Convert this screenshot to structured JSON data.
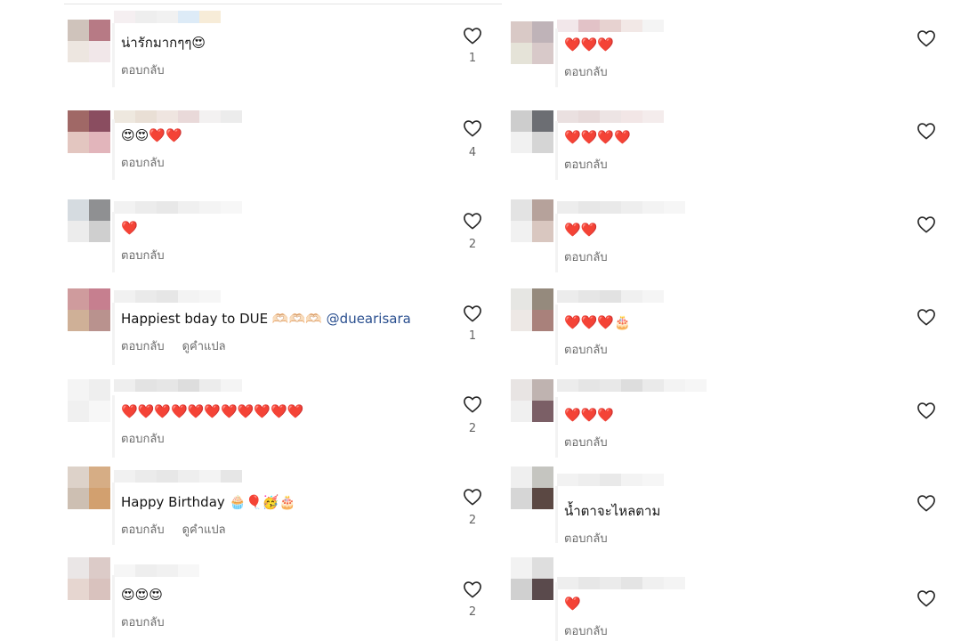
{
  "labels": {
    "reply": "ตอบกลับ",
    "translate": "ดูคำแปล"
  },
  "left_comments": [
    {
      "text": "น่ารักมากๆๆ😍",
      "likes": "1",
      "show_translate": false
    },
    {
      "text": "😍😍❤️❤️",
      "likes": "4",
      "show_translate": false
    },
    {
      "text": "❤️",
      "likes": "2",
      "show_translate": false
    },
    {
      "text": "Happiest bday to DUE 🫶🏻🫶🏻🫶🏻",
      "mention": "@duearisara",
      "likes": "1",
      "show_translate": true
    },
    {
      "text": "❤️❤️❤️❤️❤️❤️❤️❤️❤️❤️❤️",
      "likes": "2",
      "show_translate": false
    },
    {
      "text": "Happy Birthday 🧁🎈🥳🎂",
      "likes": "2",
      "show_translate": true
    },
    {
      "text": "😍😍😍",
      "likes": "2",
      "show_translate": false
    }
  ],
  "right_comments": [
    {
      "text": "❤️❤️❤️"
    },
    {
      "text": "❤️❤️❤️❤️"
    },
    {
      "text": "❤️❤️"
    },
    {
      "text": "❤️❤️❤️🎂"
    },
    {
      "text": "❤️❤️❤️"
    },
    {
      "text": "น้ำตาจะไหลตาม"
    },
    {
      "text": "❤️"
    }
  ],
  "colors": {
    "reply_gray": "#6b6b6b",
    "mention_blue": "#2a4f8f",
    "heart_outline": "#262626"
  },
  "icons": {
    "like": "heart-outline-icon"
  }
}
